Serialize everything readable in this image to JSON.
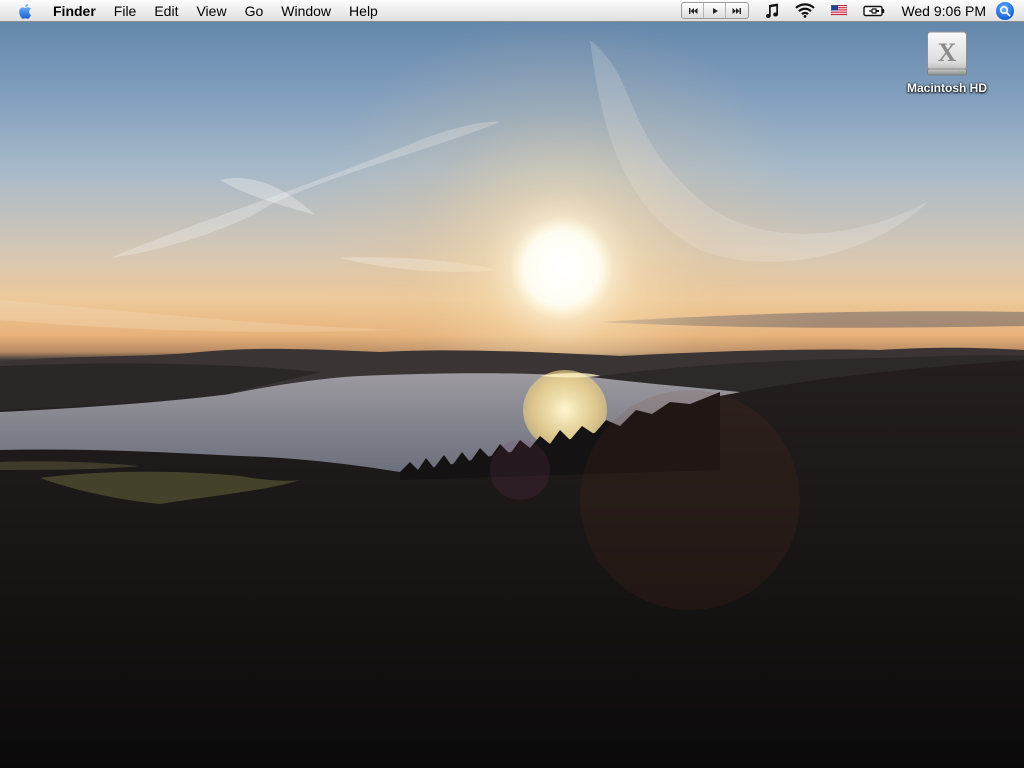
{
  "menubar": {
    "apple_icon": "apple-icon",
    "app_name": "Finder",
    "menus": [
      "File",
      "Edit",
      "View",
      "Go",
      "Window",
      "Help"
    ],
    "media_controls": [
      "previous-track-icon",
      "play-icon",
      "next-track-icon"
    ],
    "status_icons": [
      "itunes-note-icon",
      "wifi-icon",
      "us-flag-icon",
      "battery-icon"
    ],
    "clock": "Wed 9:06 PM",
    "spotlight_icon": "spotlight-icon"
  },
  "desktop": {
    "icons": [
      {
        "label": "Macintosh HD",
        "icon": "hard-drive-icon"
      }
    ],
    "wallpaper": "sunset-over-fjord"
  }
}
